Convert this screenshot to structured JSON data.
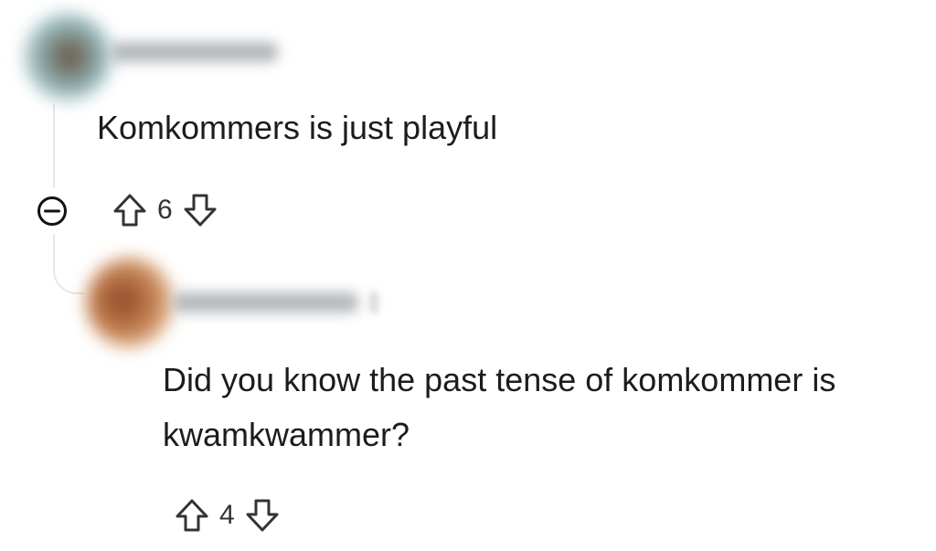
{
  "thread": {
    "comments": [
      {
        "body": "Komkommers is just playful",
        "score": "6"
      },
      {
        "body_line1": "Did you know the past tense of komkommer is",
        "body_line2": "kwamkwammer?",
        "score": "4"
      }
    ]
  },
  "icons": {
    "collapse": "collapse-circle-minus-icon",
    "upvote": "upvote-arrow-icon",
    "downvote": "downvote-arrow-icon"
  },
  "colors": {
    "text": "#1c1c1c",
    "icon": "#333333",
    "thread_line": "#e5e7e9"
  }
}
